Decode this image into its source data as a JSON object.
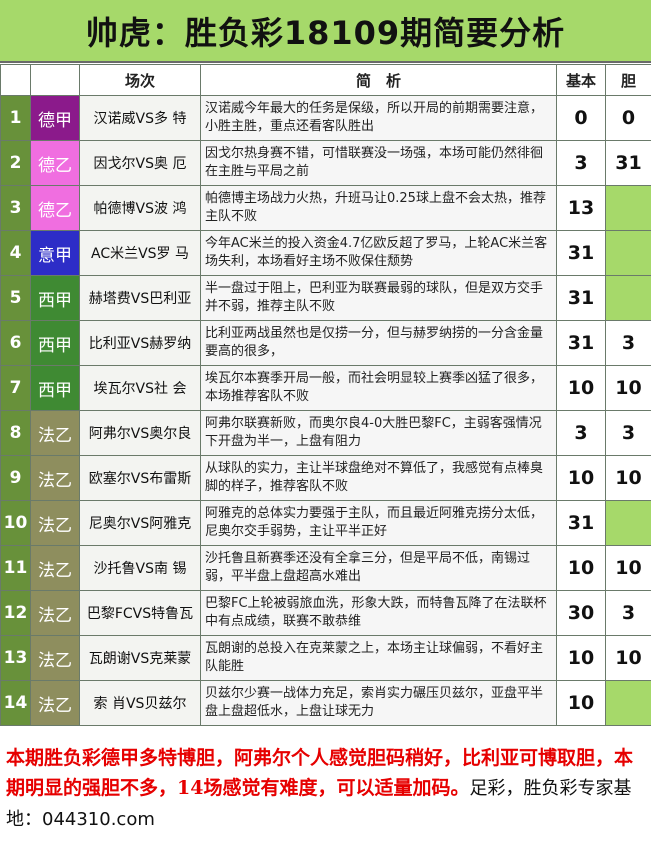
{
  "title": "帅虎：胜负彩18109期简要分析",
  "header": {
    "match": "场次",
    "brief": "简　析",
    "base": "基本",
    "dan": "胆"
  },
  "colors": {
    "德甲": "#8b1a8b",
    "德乙": "#f06ee0",
    "意甲": "#2d2dc7",
    "西甲": "#3f8a33",
    "法乙": "#8e8e5e"
  },
  "rows": [
    {
      "no": "1",
      "league": "德甲",
      "match": "汉诺威VS多 特",
      "brief": "汉诺威今年最大的任务是保级，所以开局的前期需要注意，小胜主胜，重点还看客队胜出",
      "base": "0",
      "dan": "0"
    },
    {
      "no": "2",
      "league": "德乙",
      "match": "因戈尔VS奥 厄",
      "brief": "因戈尔热身赛不错，可惜联赛没一场强，本场可能仍然徘徊在主胜与平局之前",
      "base": "3",
      "dan": "31"
    },
    {
      "no": "3",
      "league": "德乙",
      "match": "帕德博VS波 鸿",
      "brief": "帕德博主场战力火热，升班马让0.25球上盘不会太热，推荐主队不败",
      "base": "13",
      "dan": ""
    },
    {
      "no": "4",
      "league": "意甲",
      "match": "AC米兰VS罗 马",
      "brief": "今年AC米兰的投入资金4.7亿欧反超了罗马，上轮AC米兰客场失利，本场看好主场不败保住颓势",
      "base": "31",
      "dan": ""
    },
    {
      "no": "5",
      "league": "西甲",
      "match": "赫塔费VS巴利亚",
      "brief": "半一盘过于阻上，巴利亚为联赛最弱的球队，但是双方交手并不弱，推荐主队不败",
      "base": "31",
      "dan": ""
    },
    {
      "no": "6",
      "league": "西甲",
      "match": "比利亚VS赫罗纳",
      "brief": "比利亚两战虽然也是仅捞一分，但与赫罗纳捞的一分含金量要高的很多，",
      "base": "31",
      "dan": "3"
    },
    {
      "no": "7",
      "league": "西甲",
      "match": "埃瓦尔VS社 会",
      "brief": "埃瓦尔本赛季开局一般，而社会明显较上赛季凶猛了很多，本场推荐客队不败",
      "base": "10",
      "dan": "10"
    },
    {
      "no": "8",
      "league": "法乙",
      "match": "阿弗尔VS奥尔良",
      "brief": "阿弗尔联赛新败，而奥尔良4-0大胜巴黎FC，主弱客强情况下开盘为半一，上盘有阻力",
      "base": "3",
      "dan": "3"
    },
    {
      "no": "9",
      "league": "法乙",
      "match": "欧塞尔VS布雷斯",
      "brief": "从球队的实力，主让半球盘绝对不算低了，我感觉有点棒臭脚的样子，推荐客队不败",
      "base": "10",
      "dan": "10"
    },
    {
      "no": "10",
      "league": "法乙",
      "match": "尼奥尔VS阿雅克",
      "brief": "阿雅克的总体实力要强于主队，而且最近阿雅克捞分太低，尼奥尔交手弱势，主让平半正好",
      "base": "31",
      "dan": ""
    },
    {
      "no": "11",
      "league": "法乙",
      "match": "沙托鲁VS南 锡",
      "brief": "沙托鲁且新赛季还没有全拿三分，但是平局不低，南锡过弱，平半盘上盘超高水难出",
      "base": "10",
      "dan": "10"
    },
    {
      "no": "12",
      "league": "法乙",
      "match": "巴黎FCVS特鲁瓦",
      "brief": "巴黎FC上轮被弱旅血洗，形象大跌，而特鲁瓦降了在法联杯中有点成绩，联赛不敢恭维",
      "base": "30",
      "dan": "3"
    },
    {
      "no": "13",
      "league": "法乙",
      "match": "瓦朗谢VS克莱蒙",
      "brief": "瓦朗谢的总投入在克莱蒙之上，本场主让球偏弱，不看好主队能胜",
      "base": "10",
      "dan": "10"
    },
    {
      "no": "14",
      "league": "法乙",
      "match": "索 肖VS贝兹尔",
      "brief": "贝兹尔少赛一战体力充足，索肖实力碾压贝兹尔，亚盘平半盘上盘超低水，上盘让球无力",
      "base": "10",
      "dan": ""
    }
  ],
  "footer": {
    "text": "本期胜负彩德甲多特博胆，阿弗尔个人感觉胆码稍好，比利亚可博取胆，本期明显的强胆不多，14场感觉有难度，可以适量加码。",
    "plain": "足彩，胜负彩专家基地：044310.com"
  }
}
